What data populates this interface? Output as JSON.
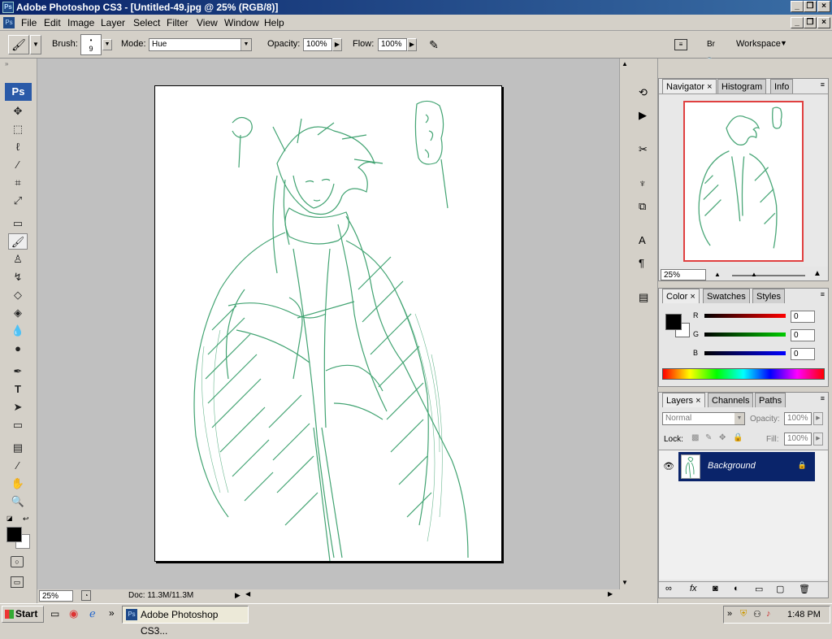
{
  "window": {
    "title": "Adobe Photoshop CS3 - [Untitled-49.jpg @ 25% (RGB/8)]",
    "app_icon": "Ps"
  },
  "menus": [
    "File",
    "Edit",
    "Image",
    "Layer",
    "Select",
    "Filter",
    "View",
    "Window",
    "Help"
  ],
  "options": {
    "brush_label": "Brush:",
    "brush_size": "9",
    "mode_label": "Mode:",
    "mode_value": "Hue",
    "opacity_label": "Opacity:",
    "opacity_value": "100%",
    "flow_label": "Flow:",
    "flow_value": "100%",
    "workspace_label": "Workspace"
  },
  "toolbox": {
    "logo": "Ps"
  },
  "status": {
    "zoom": "25%",
    "doc": "Doc: 11.3M/11.3M"
  },
  "navigator": {
    "tabs": [
      "Navigator",
      "Histogram",
      "Info"
    ],
    "zoom": "25%"
  },
  "color_panel": {
    "tabs": [
      "Color",
      "Swatches",
      "Styles"
    ],
    "r_label": "R",
    "r_value": "0",
    "g_label": "G",
    "g_value": "0",
    "b_label": "B",
    "b_value": "0"
  },
  "layers_panel": {
    "tabs": [
      "Layers",
      "Channels",
      "Paths"
    ],
    "blend_mode": "Normal",
    "opacity_label": "Opacity:",
    "opacity_value": "100%",
    "lock_label": "Lock:",
    "fill_label": "Fill:",
    "fill_value": "100%",
    "layer_name": "Background"
  },
  "taskbar": {
    "start": "Start",
    "task": "Adobe Photoshop CS3...",
    "time": "1:48 PM",
    "chevron": "»"
  },
  "colors": {
    "sketch": "#2e9a63",
    "titlebar": "#0a246a",
    "layer_selected": "#0a246a",
    "nav_frame": "#e04040"
  }
}
